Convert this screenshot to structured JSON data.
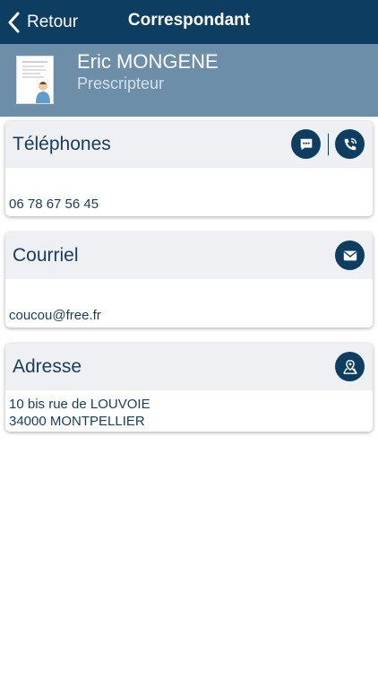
{
  "nav": {
    "back_label": "Retour",
    "title": "Correspondant"
  },
  "profile": {
    "name": "Eric MONGENE",
    "role": "Prescripteur"
  },
  "phones": {
    "title": "Téléphones",
    "number": "06 78 67 56 45",
    "icons": [
      "sms-icon",
      "call-icon"
    ]
  },
  "email": {
    "title": "Courriel",
    "address": "coucou@free.fr",
    "icon": "mail-icon"
  },
  "address": {
    "title": "Adresse",
    "line1": "10 bis rue de LOUVOIE",
    "line2": "34000 MONTPELLIER",
    "icon": "map-icon"
  },
  "colors": {
    "navbar": "#0e3d62",
    "profile_band": "#6d8ea8",
    "card_header": "#eef0f4",
    "text": "#173c5d"
  }
}
